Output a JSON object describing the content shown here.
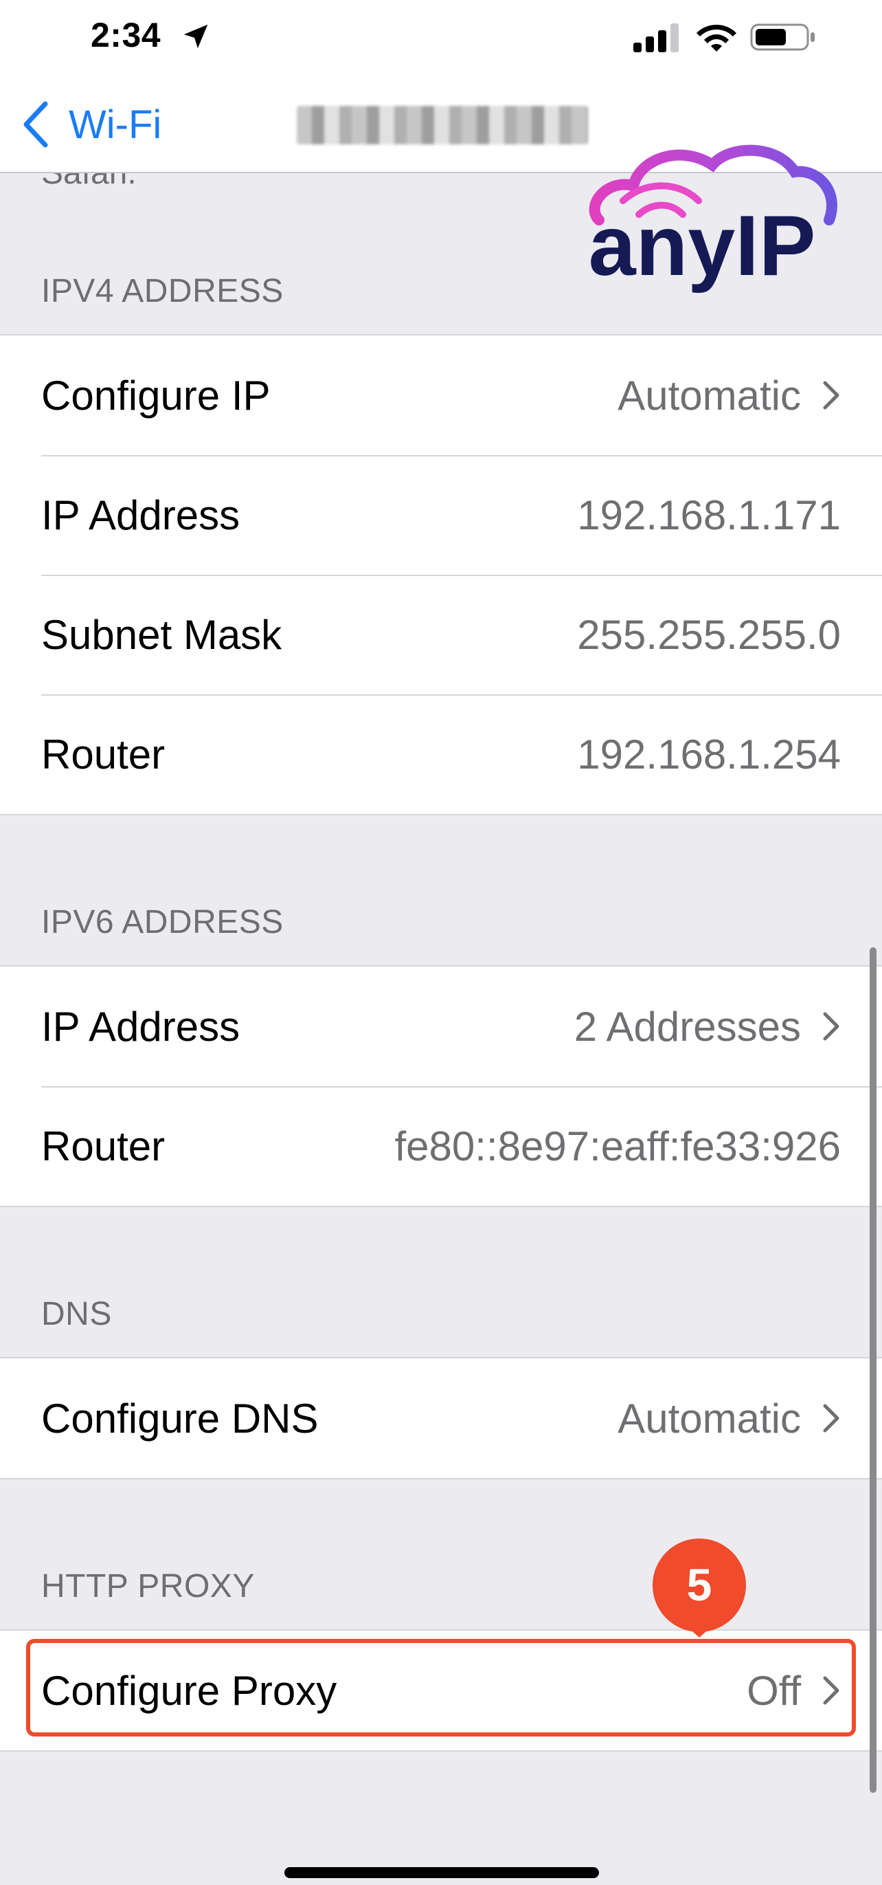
{
  "status_bar": {
    "time": "2:34"
  },
  "nav": {
    "back_label": "Wi-Fi"
  },
  "logo": {
    "text": "anyIP"
  },
  "cut_text": "Safari.",
  "sections": {
    "ipv4": {
      "header": "IPV4 ADDRESS",
      "rows": [
        {
          "label": "Configure IP",
          "value": "Automatic"
        },
        {
          "label": "IP Address",
          "value": "192.168.1.171"
        },
        {
          "label": "Subnet Mask",
          "value": "255.255.255.0"
        },
        {
          "label": "Router",
          "value": "192.168.1.254"
        }
      ]
    },
    "ipv6": {
      "header": "IPV6 ADDRESS",
      "rows": [
        {
          "label": "IP Address",
          "value": "2 Addresses"
        },
        {
          "label": "Router",
          "value": "fe80::8e97:eaff:fe33:926"
        }
      ]
    },
    "dns": {
      "header": "DNS",
      "rows": [
        {
          "label": "Configure DNS",
          "value": "Automatic"
        }
      ]
    },
    "http_proxy": {
      "header": "HTTP PROXY",
      "rows": [
        {
          "label": "Configure Proxy",
          "value": "Off"
        }
      ]
    }
  },
  "annotation": {
    "step": "5",
    "color": "#ef4b2c"
  },
  "colors": {
    "accent": "#1a7cf5",
    "background": "#ebebf0"
  },
  "icons": [
    "location-arrow-icon",
    "cellular-signal-icon",
    "wifi-icon",
    "battery-icon",
    "chevron-left-icon",
    "chevron-right-icon"
  ]
}
